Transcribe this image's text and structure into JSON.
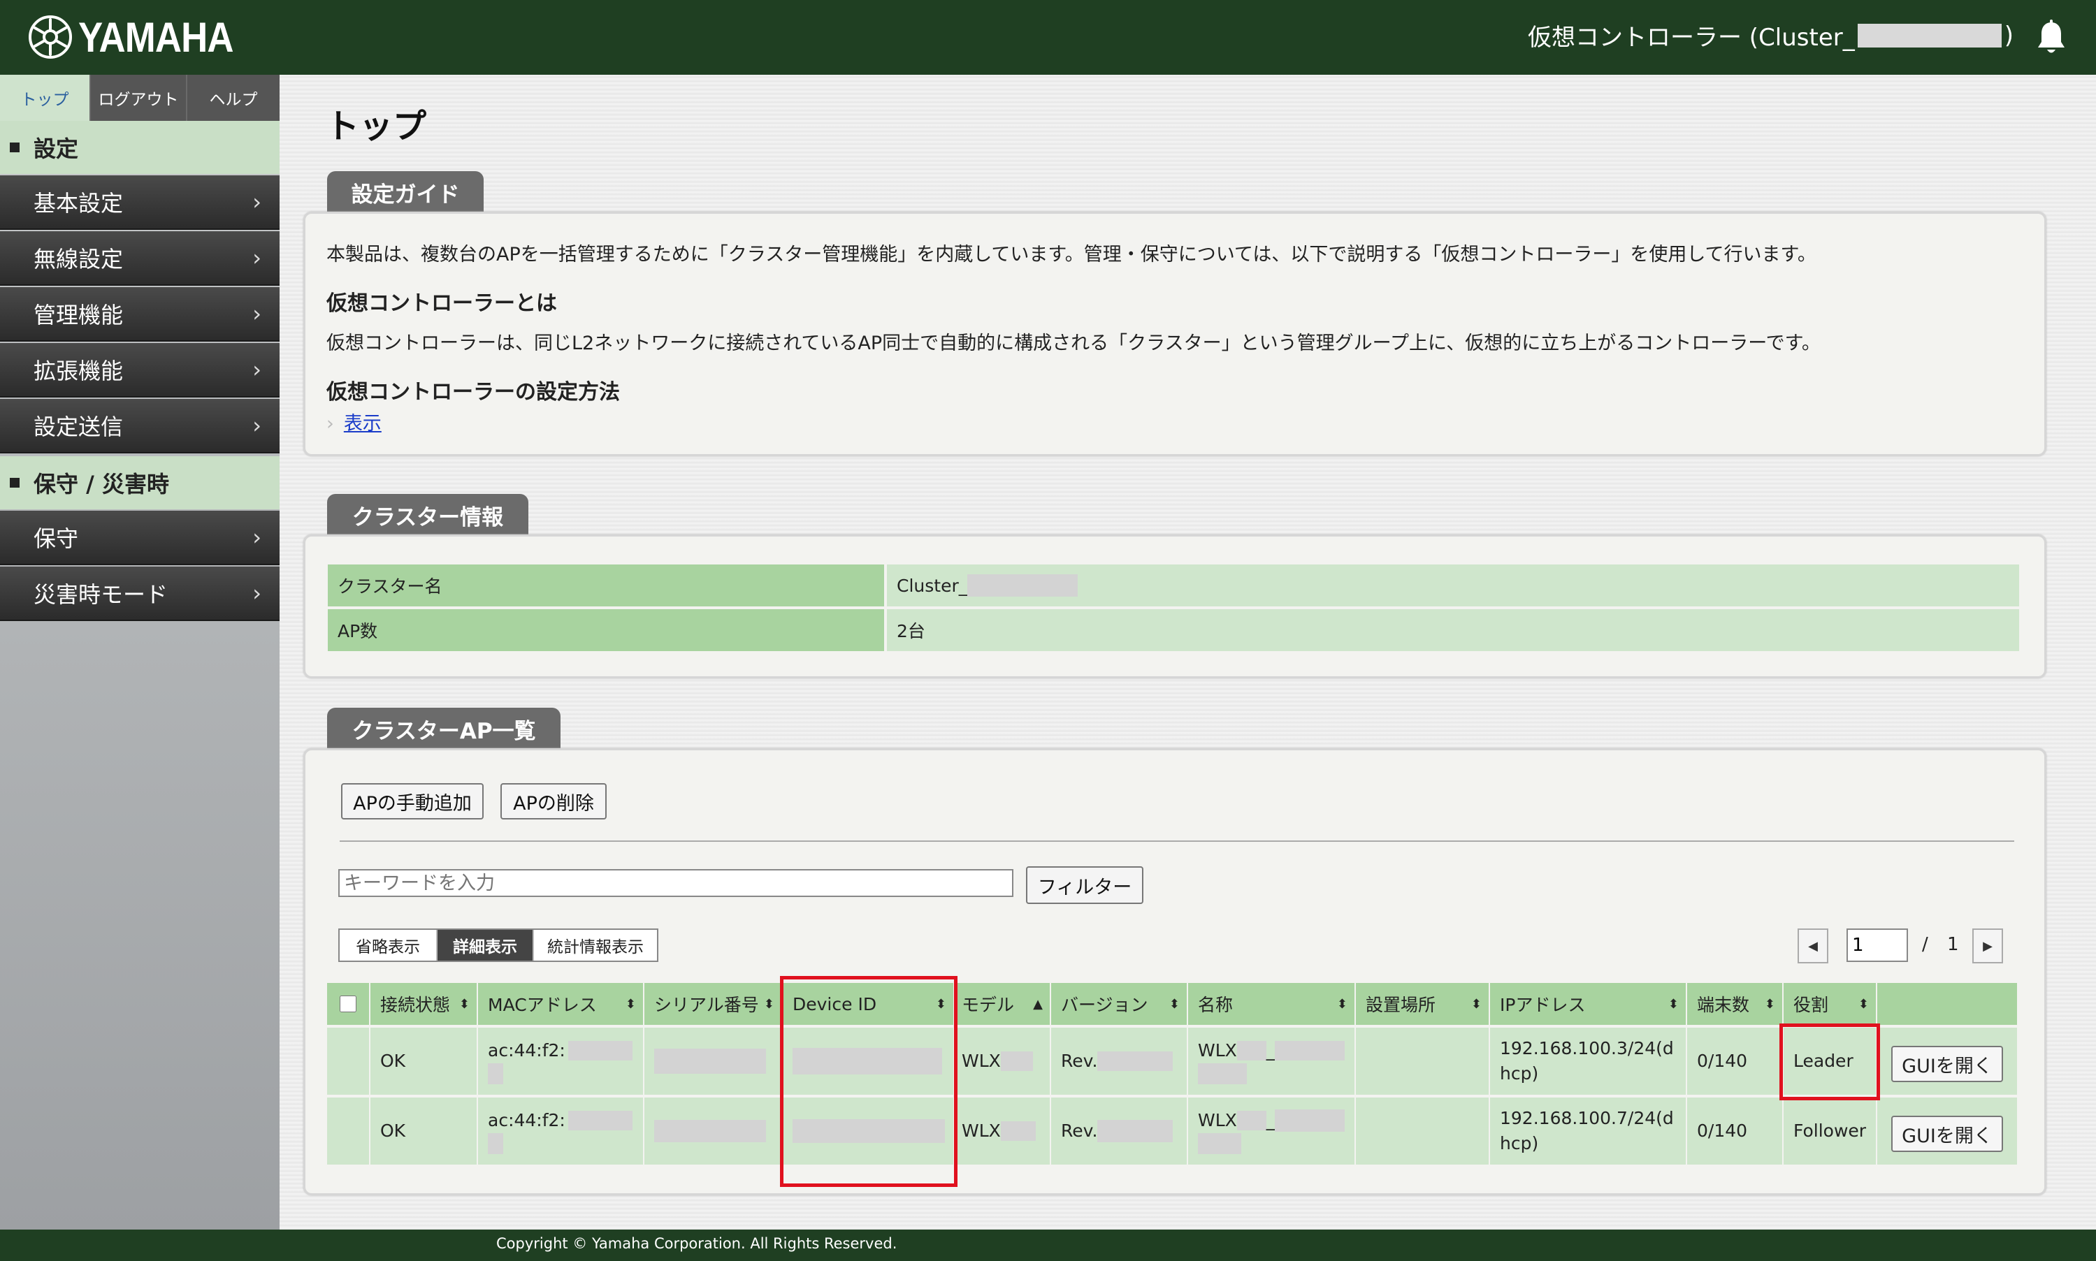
{
  "header": {
    "logo_text": "YAMAHA",
    "title_prefix": "仮想コントローラー (Cluster_",
    "title_suffix": ")"
  },
  "sidebar": {
    "tabs": [
      {
        "label": "トップ"
      },
      {
        "label": "ログアウト"
      },
      {
        "label": "ヘルプ"
      }
    ],
    "sections": [
      {
        "label": "設定",
        "items": [
          "基本設定",
          "無線設定",
          "管理機能",
          "拡張機能",
          "設定送信"
        ]
      },
      {
        "label": "保守 / 災害時",
        "items": [
          "保守",
          "災害時モード"
        ]
      }
    ]
  },
  "main": {
    "page_title": "トップ",
    "guide": {
      "tab_label": "設定ガイド",
      "intro": "本製品は、複数台のAPを一括管理するために「クラスター管理機能」を内蔵しています。管理・保守については、以下で説明する「仮想コントローラー」を使用して行います。",
      "h1": "仮想コントローラーとは",
      "p1": "仮想コントローラーは、同じL2ネットワークに接続されているAP同士で自動的に構成される「クラスター」という管理グループ上に、仮想的に立ち上がるコントローラーです。",
      "h2": "仮想コントローラーの設定方法",
      "link": "表示"
    },
    "cluster_info": {
      "tab_label": "クラスター情報",
      "rows": [
        {
          "key": "クラスター名",
          "value": "Cluster_"
        },
        {
          "key": "AP数",
          "value": "2台"
        }
      ]
    },
    "ap_list": {
      "tab_label": "クラスターAP一覧",
      "add_button": "APの手動追加",
      "delete_button": "APの削除",
      "search_placeholder": "キーワードを入力",
      "filter_button": "フィルター",
      "view_tabs": [
        "省略表示",
        "詳細表示",
        "統計情報表示"
      ],
      "page_current": "1",
      "page_sep": "/",
      "page_total": "1",
      "columns": [
        "接続状態",
        "MACアドレス",
        "シリアル番号",
        "Device ID",
        "モデル",
        "バージョン",
        "名称",
        "設置場所",
        "IPアドレス",
        "端末数",
        "役割"
      ],
      "rows": [
        {
          "status": "OK",
          "mac": "ac:44:f2:",
          "model": "WLX",
          "version": "Rev.",
          "name": "WLX",
          "name_sep": "_",
          "ip1": "192.168.100.3/24(d",
          "ip2": "hcp)",
          "clients": "0/140",
          "role": "Leader",
          "gui": "GUIを開く"
        },
        {
          "status": "OK",
          "mac": "ac:44:f2:",
          "model": "WLX",
          "version": "Rev.",
          "name": "WLX",
          "name_sep": "_",
          "ip1": "192.168.100.7/24(d",
          "ip2": "hcp)",
          "clients": "0/140",
          "role": "Follower",
          "gui": "GUIを開く"
        }
      ]
    }
  },
  "footer": {
    "copyright": "Copyright © Yamaha Corporation. All Rights Reserved."
  },
  "colors": {
    "header_bg": "#1f3f22",
    "table_header": "#a8d39f",
    "table_cell": "#cfe6cc",
    "highlight": "#e0111e"
  }
}
